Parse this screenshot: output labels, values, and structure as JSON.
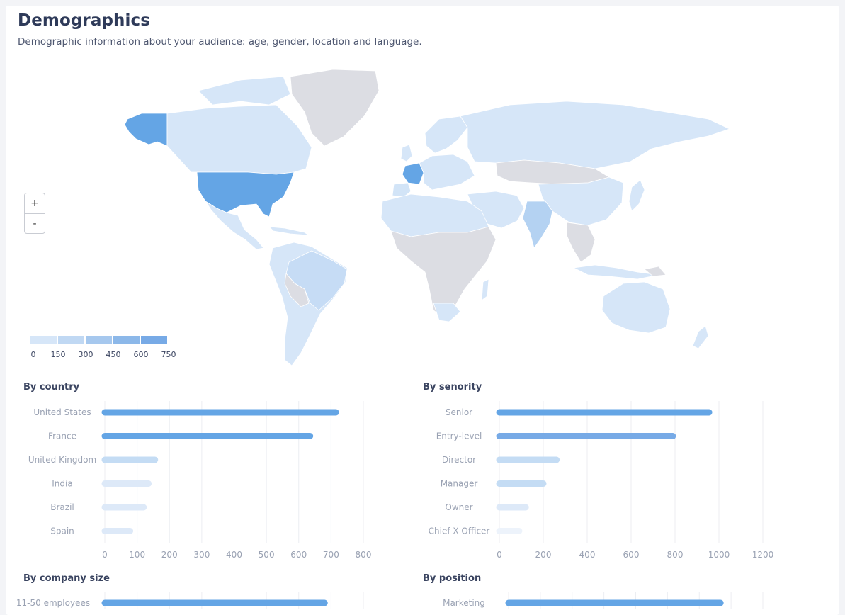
{
  "header": {
    "title": "Demographics",
    "subtitle": "Demographic information about your audience: age, gender, location and language."
  },
  "map": {
    "zoom_in_label": "+",
    "zoom_out_label": "-",
    "legend_ticks": [
      "0",
      "150",
      "300",
      "450",
      "600",
      "750"
    ],
    "legend_colors": [
      "#d6e6f8",
      "#c0d8f3",
      "#a6c8ee",
      "#8cb8e9",
      "#77aae6",
      "#63a3e5"
    ],
    "highlighted_countries": [
      {
        "name": "United States",
        "level": "high"
      },
      {
        "name": "France",
        "level": "high"
      },
      {
        "name": "India",
        "level": "medium"
      },
      {
        "name": "Brazil",
        "level": "low"
      }
    ],
    "colors": {
      "high": "#64a5e5",
      "medium": "#b4d2f2",
      "low": "#d2e4f7",
      "none": "#dcdde3"
    }
  },
  "sections": {
    "country": {
      "title": "By country"
    },
    "seniority": {
      "title": "By senority"
    },
    "company_size": {
      "title": "By company size"
    },
    "position": {
      "title": "By position"
    }
  },
  "chart_data": [
    {
      "type": "bar",
      "title": "By country",
      "orientation": "horizontal",
      "categories": [
        "United States",
        "France",
        "United Kingdom",
        "India",
        "Brazil",
        "Spain"
      ],
      "values": [
        715,
        635,
        155,
        135,
        120,
        78
      ],
      "xlim": [
        0,
        800
      ],
      "xticks": [
        "0",
        "100",
        "200",
        "300",
        "400",
        "500",
        "600",
        "700",
        "800"
      ]
    },
    {
      "type": "bar",
      "title": "By senority",
      "orientation": "horizontal",
      "categories": [
        "Senior",
        "Entry-level",
        "Director",
        "Manager",
        "Owner",
        "Chief X Officer"
      ],
      "values": [
        955,
        790,
        260,
        200,
        120,
        90
      ],
      "xlim": [
        0,
        1200
      ],
      "xticks": [
        "0",
        "200",
        "400",
        "600",
        "800",
        "1000",
        "1200"
      ]
    },
    {
      "type": "bar",
      "title": "By company size",
      "orientation": "horizontal",
      "categories": [
        "11-50 employees"
      ],
      "values": [
        680
      ],
      "xlim": [
        0,
        800
      ]
    },
    {
      "type": "bar",
      "title": "By position",
      "orientation": "horizontal",
      "categories": [
        "Marketing"
      ],
      "values": [
        1000
      ],
      "xlim": [
        0,
        1200
      ]
    }
  ]
}
